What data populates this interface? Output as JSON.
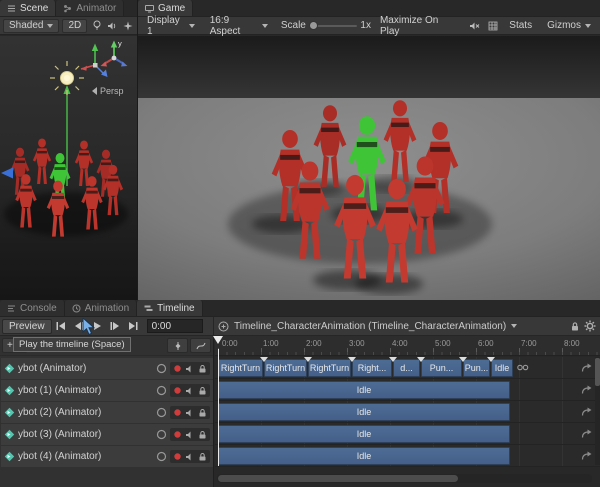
{
  "scene": {
    "tabs": [
      {
        "label": "Scene"
      },
      {
        "label": "Animator"
      }
    ],
    "toolbar": {
      "shading": "Shaded",
      "mode_2d": "2D"
    },
    "viewport": {
      "persp_label": "Persp",
      "axis_y_label": "y"
    }
  },
  "game": {
    "tab_label": "Game",
    "toolbar": {
      "display": "Display 1",
      "aspect": "16:9 Aspect",
      "scale_label": "Scale",
      "scale_value": "1x",
      "maximize": "Maximize On Play",
      "stats": "Stats",
      "gizmos": "Gizmos"
    }
  },
  "timeline": {
    "tabs": [
      {
        "label": "Console"
      },
      {
        "label": "Animation"
      },
      {
        "label": "Timeline"
      }
    ],
    "toolbar": {
      "preview": "Preview",
      "timecode": "0:00",
      "asset": "Timeline_CharacterAnimation (Timeline_CharacterAnimation)"
    },
    "add_button": "+",
    "tooltip": "Play the timeline (Space)",
    "tracks": [
      {
        "label": "ybot (Animator)"
      },
      {
        "label": "ybot (1) (Animator)"
      },
      {
        "label": "ybot (2) (Animator)"
      },
      {
        "label": "ybot (3) (Animator)"
      },
      {
        "label": "ybot (4) (Animator)"
      }
    ],
    "ruler_labels": [
      "0:00",
      "1:00",
      "2:00",
      "3:00",
      "4:00",
      "5:00",
      "6:00",
      "7:00",
      "8:00"
    ],
    "track0_clips": [
      {
        "label": "RightTurn"
      },
      {
        "label": "RightTurn"
      },
      {
        "label": "RightTurn"
      },
      {
        "label": "Right..."
      },
      {
        "label": "d..."
      },
      {
        "label": "Pun..."
      },
      {
        "label": "Pun..."
      },
      {
        "label": "Idle"
      }
    ],
    "idle_clip_label": "Idle"
  },
  "colors": {
    "clip_blue": "#47658c",
    "character_green": "#3fc437",
    "character_red": "#b23028",
    "record_red": "#d03b3b",
    "panel_dark": "#282828"
  }
}
